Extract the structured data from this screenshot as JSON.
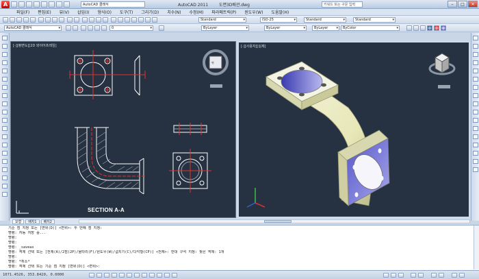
{
  "titlebar": {
    "workspace": "AutoCAD 클래식",
    "app_title": "AutoCAD 2011",
    "file_title": "도면3D배관.dwg",
    "search_placeholder": "키워드 또는 구문 입력"
  },
  "menubar": {
    "items": [
      "파일(F)",
      "편집(E)",
      "뷰(V)",
      "삽입(I)",
      "형식(O)",
      "도구(T)",
      "그리기(D)",
      "치수(N)",
      "수정(M)",
      "파라메트릭(P)",
      "윈도우(W)",
      "도움말(H)"
    ]
  },
  "toolbar1": {
    "text_style": "Standard",
    "dim_style": "ISO-25",
    "table_style": "Standard",
    "mleader_style": "Standard"
  },
  "toolbar2": {
    "workspace2": "AutoCAD 클래식",
    "layer": "0",
    "color": "ByLayer",
    "linetype": "ByLayer",
    "lineweight": "ByLayer",
    "plotstyle": "ByColor"
  },
  "viewports": {
    "left_label": "[-][평면도][2D 와이어프레임]",
    "right_label": "[-][사용자][실제]",
    "section_text": "SECTION A-A"
  },
  "layout_tabs": [
    "모형",
    "배치1",
    "배치2"
  ],
  "command_lines": [
    "기준 점 지정 또는 [변위(D)] <변위>: 두 번째 점 지정:",
    "명령: 자동 저장 중...",
    "명령:",
    "명령:",
    "명령: _saveas",
    "명령: 객체 선택 또는 [전체(A)/2점(2P)/울타리(F)/윈도우(W)/걸치기(C)/다각형(CP)] <전체>: 반대 구석 지정: 찾은 객체: 1개",
    "명령:",
    "명령: *취소*",
    "명령: 객체 선택 또는 기준 점 지정 [변위(D)] <변위>:"
  ],
  "statusbar": {
    "coords": "1071.4526, 353.8420, 0.0000"
  },
  "colors": {
    "viewport_bg": "#263241",
    "accent_red": "#e23030",
    "ui_blue": "#c9d6e6"
  }
}
